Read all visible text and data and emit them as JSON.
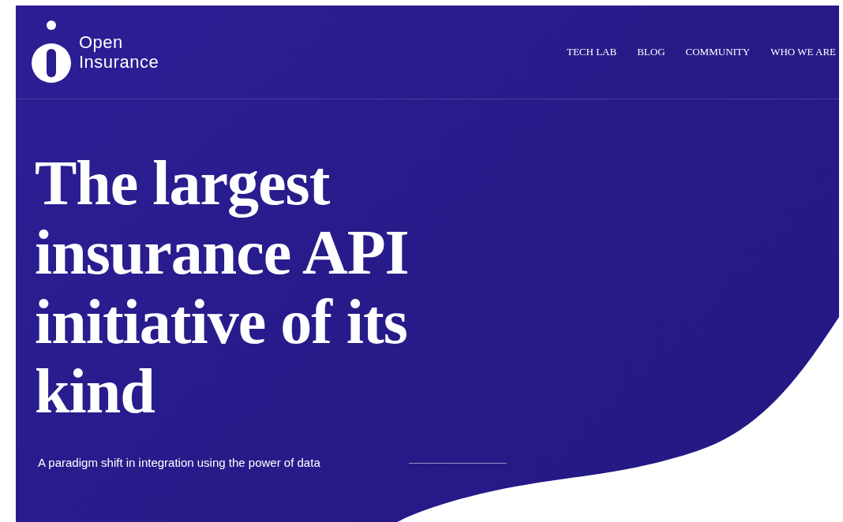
{
  "header": {
    "logo": {
      "line_1": "Open",
      "line_2": "Insurance"
    },
    "nav": [
      {
        "label": "TECH LAB"
      },
      {
        "label": "BLOG"
      },
      {
        "label": "COMMUNITY"
      },
      {
        "label": "WHO WE ARE"
      }
    ]
  },
  "hero": {
    "headline": "The largest insurance API initiative of its kind",
    "subtitle": "A paradigm shift in integration using the power of data"
  }
}
